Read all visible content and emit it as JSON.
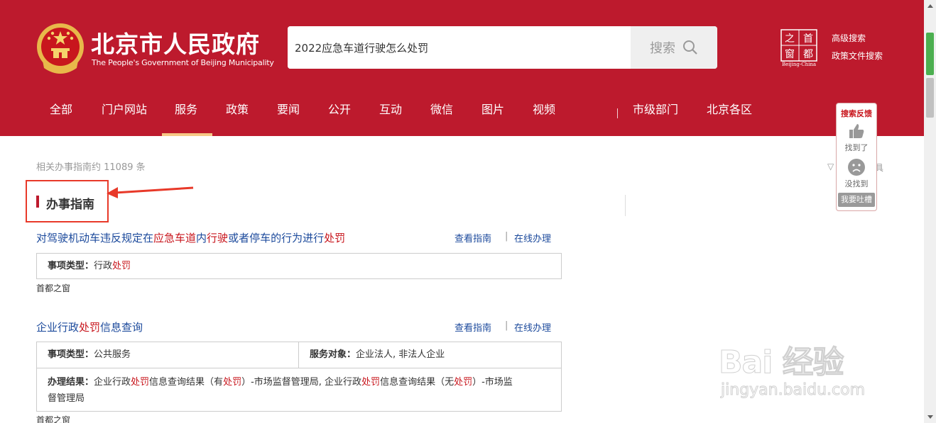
{
  "header": {
    "title": "北京市人民政府",
    "subtitle": "The People's Government of Beijing Municipality",
    "search_value": "2022应急车道行驶怎么处罚",
    "search_button": "搜索",
    "capital_logo_chars": [
      "之",
      "首",
      "窗",
      "都"
    ],
    "capital_logo_caption": "Beijing-China",
    "advanced_search": "高级搜索",
    "policy_search": "政策文件搜索",
    "colors": {
      "brand": "#bd1a2d",
      "active_underline": "#f6c886"
    }
  },
  "nav": {
    "items": [
      "全部",
      "门户网站",
      "服务",
      "政策",
      "要闻",
      "公开",
      "互动",
      "微信",
      "图片",
      "视频"
    ],
    "right_items": [
      "市级部门",
      "北京各区"
    ],
    "active": "服务"
  },
  "content": {
    "count_text": "相关办事指南约 11089 条",
    "section_title": "办事指南",
    "filter_fragment": "▽",
    "filter_tail": "具",
    "results": [
      {
        "title_parts": [
          {
            "t": "对驾驶机动车违反规定在",
            "hl": false
          },
          {
            "t": "应急车道",
            "hl": true
          },
          {
            "t": "内",
            "hl": false
          },
          {
            "t": "行驶",
            "hl": true
          },
          {
            "t": "或者停车的行为进行",
            "hl": false
          },
          {
            "t": "处罚",
            "hl": true
          }
        ],
        "link_guide": "查看指南",
        "link_online": "在线办理",
        "type_label": "事项类型：",
        "type_value_parts": [
          {
            "t": "行政",
            "hl": false
          },
          {
            "t": "处罚",
            "hl": true
          }
        ],
        "source": "首都之窗"
      },
      {
        "title_parts": [
          {
            "t": "企业行政",
            "hl": false
          },
          {
            "t": "处罚",
            "hl": true
          },
          {
            "t": "信息查询",
            "hl": false
          }
        ],
        "link_guide": "查看指南",
        "link_online": "在线办理",
        "type_label": "事项类型：",
        "type_value": "公共服务",
        "target_label": "服务对象：",
        "target_value": "企业法人, 非法人企业",
        "result_label": "办理结果：",
        "result_line1_parts": [
          {
            "t": "企业行政",
            "hl": false
          },
          {
            "t": "处罚",
            "hl": true
          },
          {
            "t": "信息查询结果（有",
            "hl": false
          },
          {
            "t": "处罚",
            "hl": true
          },
          {
            "t": "）-市场监督管理局, 企业行政",
            "hl": false
          },
          {
            "t": "处罚",
            "hl": true
          },
          {
            "t": "信息查询结果（无",
            "hl": false
          },
          {
            "t": "处罚",
            "hl": true
          },
          {
            "t": "）-市场监",
            "hl": false
          }
        ],
        "result_line2": "督管理局",
        "source": "首都之窗"
      }
    ]
  },
  "feedback": {
    "title": "搜索反馈",
    "found": "找到了",
    "not_found": "没找到",
    "complain": "我要吐槽"
  },
  "watermark": {
    "big": "Bai 经验",
    "small": "jingyan.baidu.com"
  }
}
